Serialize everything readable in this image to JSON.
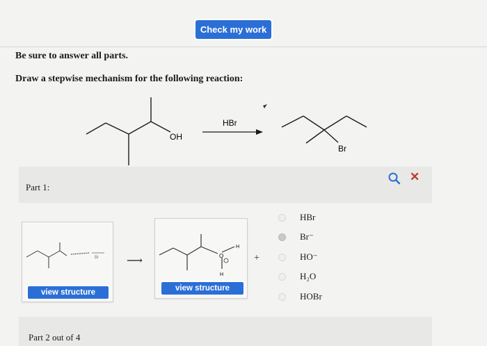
{
  "toolbar": {
    "check_label": "Check my work"
  },
  "instructions": {
    "line1": "Be sure to answer all parts.",
    "line2": "Draw a stepwise mechanism for the following reaction:"
  },
  "reaction": {
    "reagent": "HBr",
    "reactant_group": "OH",
    "product_group": "Br"
  },
  "part": {
    "label": "Part 1:",
    "view_structure_1": "view structure",
    "view_structure_2": "view structure",
    "arrow": "⟶",
    "plus": "+",
    "oxonium_h_top": "H",
    "oxonium_o": "O",
    "oxonium_h_bottom": "H"
  },
  "choices": [
    {
      "label": "HBr",
      "selected": false
    },
    {
      "label": "Br⁻",
      "selected": true
    },
    {
      "label": "HO⁻",
      "selected": false
    },
    {
      "label": "H₂O",
      "selected": false
    },
    {
      "label": "HOBr",
      "selected": false
    }
  ],
  "footer": {
    "part_count": "Part 2 out of 4"
  },
  "colors": {
    "accent": "#2b6fd6",
    "close": "#c0392b",
    "search": "#2b6fd6"
  }
}
